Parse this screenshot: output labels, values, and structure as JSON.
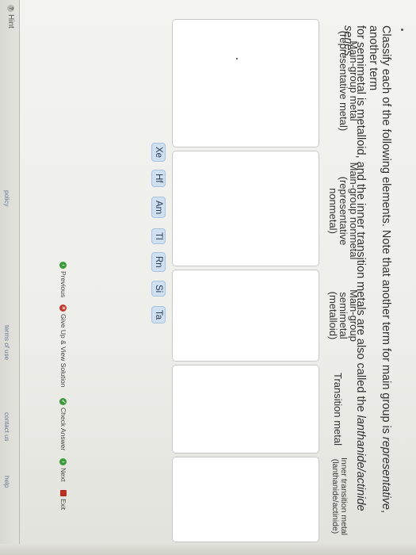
{
  "prompt": {
    "line1": "Classify each of the following elements. Note that another term for main group is ",
    "line1_emph": "representative",
    "line1_end": ", another term",
    "line2": "for semimetal is metalloid, and the inner transition metals are also called the ",
    "line2_emph": "lanthanide/actinide series."
  },
  "columns": [
    {
      "line1": "Main-group metal",
      "line2": "(representative metal)",
      "line3": ""
    },
    {
      "line1": "Main-group nonmetal",
      "line2": "(representative",
      "line3": "nonmetal)"
    },
    {
      "line1": "Main-group",
      "line2": "semimetal",
      "line3": "(metalloid)"
    },
    {
      "line1": "Transition metal",
      "line2": "",
      "line3": ""
    },
    {
      "line1": "Inner transition metal",
      "line2": "(lanthanide/actinide)",
      "line3": ""
    }
  ],
  "elements": [
    "Xe",
    "Hf",
    "Am",
    "Tl",
    "Rn",
    "Si",
    "Ta"
  ],
  "nav": {
    "previous": "Previous",
    "give_up": "Give Up & View Solution",
    "check_answer": "Check Answer",
    "next": "Next",
    "exit": "Exit"
  },
  "footer": {
    "hint": "Hint",
    "link1": "policy",
    "link2": "terms of use",
    "link3": "contact us",
    "link4": "help"
  },
  "colors": {
    "chip_bg": "#cfe0f3",
    "chip_border": "#a9c2df",
    "zone_bg": "#ffffff",
    "green_icon": "#3c9a3a",
    "red_icon": "#c23b2e"
  }
}
